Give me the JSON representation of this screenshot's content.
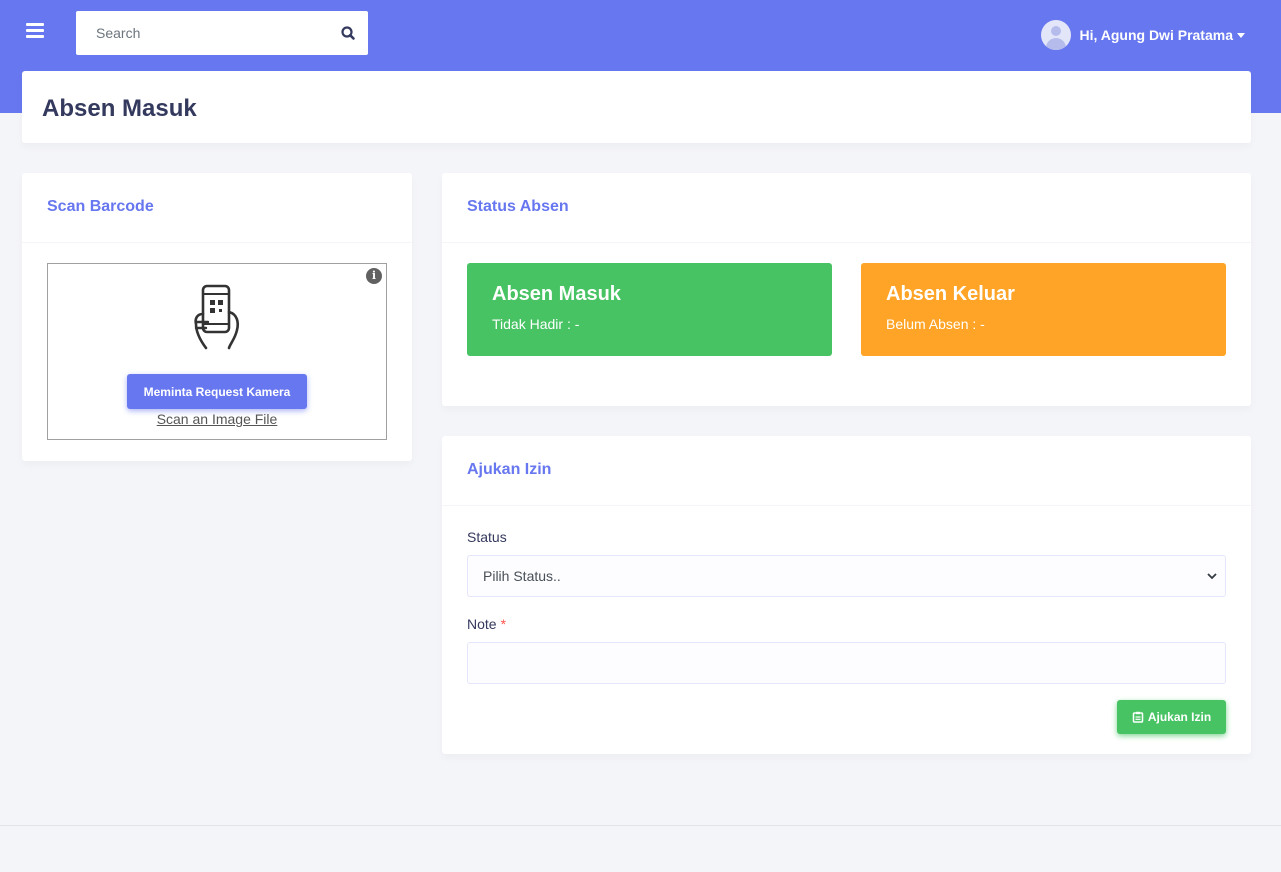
{
  "topbar": {
    "menu_icon": "hamburger-icon",
    "search_placeholder": "Search",
    "search_icon": "search-icon",
    "user_greeting": "Hi, Agung Dwi Pratama",
    "bg_color": "#6777ef"
  },
  "page": {
    "title": "Absen Masuk"
  },
  "scan_card": {
    "title": "Scan Barcode",
    "info_icon": "info-icon",
    "phone_icon": "phone-qr-scan-icon",
    "camera_button": "Meminta Request Kamera",
    "scan_file_link": "Scan an Image File"
  },
  "status_card": {
    "title": "Status Absen",
    "in": {
      "title": "Absen Masuk",
      "text": "Tidak Hadir : -",
      "color": "#47c363"
    },
    "out": {
      "title": "Absen Keluar",
      "text": "Belum Absen : -",
      "color": "#ffa426"
    }
  },
  "izin_card": {
    "title": "Ajukan Izin",
    "status_label": "Status",
    "status_value": "Pilih Status..",
    "note_label": "Note",
    "required_mark": "*",
    "note_value": "",
    "submit_label": "Ajukan Izin",
    "submit_icon": "clipboard-icon"
  }
}
